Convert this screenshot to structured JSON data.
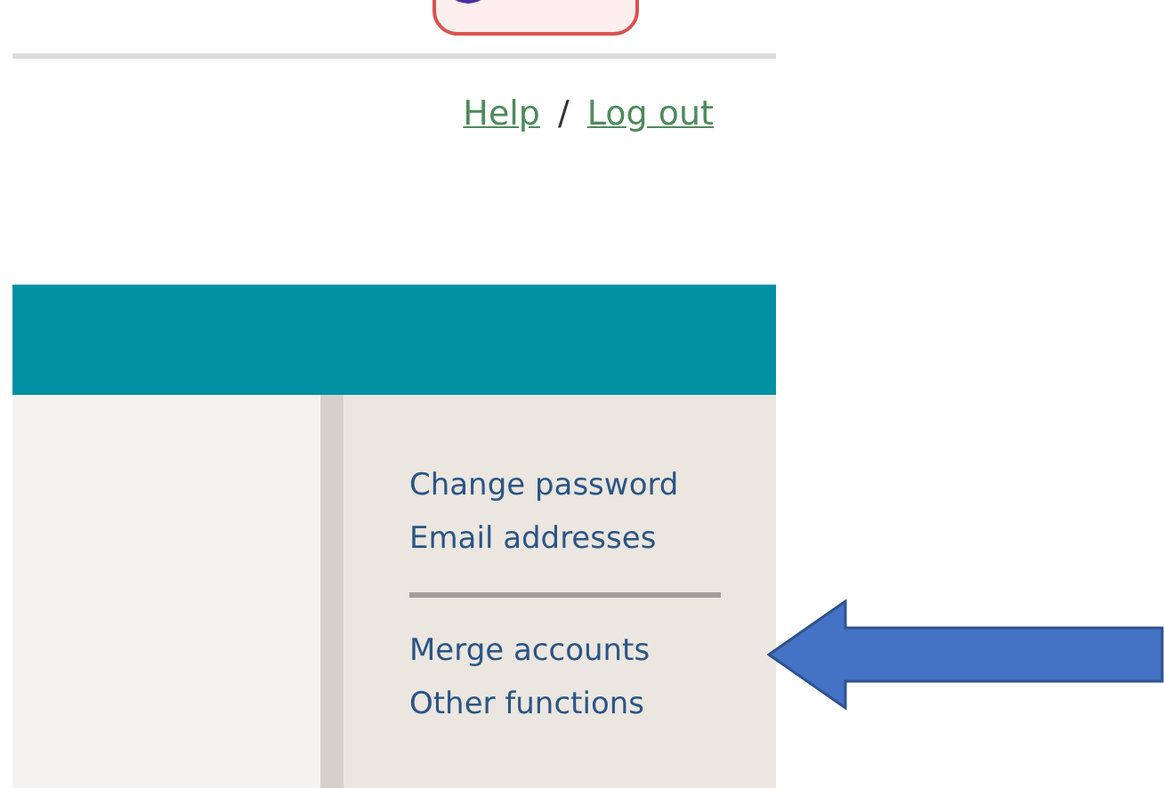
{
  "header_links": [
    {
      "label": "Help"
    },
    {
      "label": "Log out"
    }
  ],
  "header_separator": "/",
  "menu_groups": [
    {
      "items": [
        "Change password",
        "Email addresses"
      ]
    },
    {
      "items": [
        "Merge accounts",
        "Other functions"
      ]
    }
  ]
}
